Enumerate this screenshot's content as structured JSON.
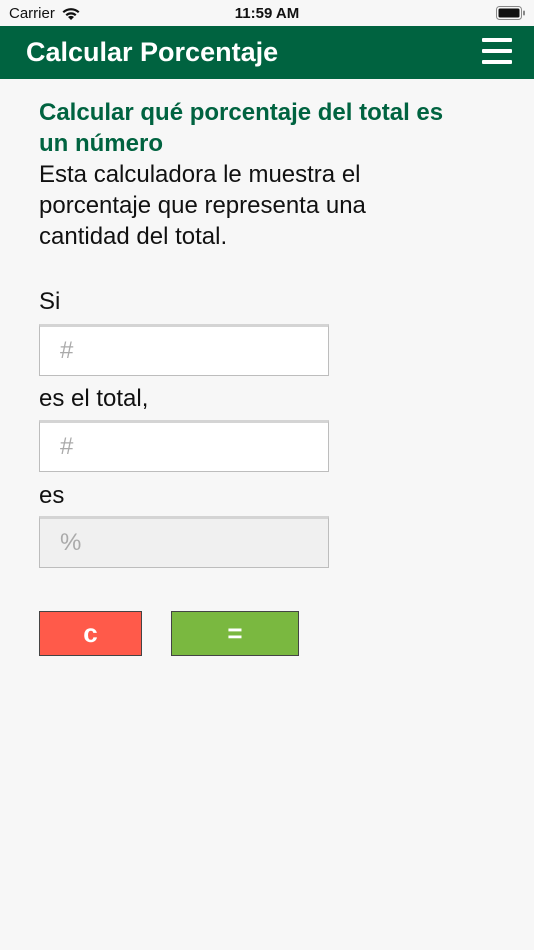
{
  "status_bar": {
    "carrier": "Carrier",
    "time": "11:59 AM"
  },
  "app_bar": {
    "title": "Calcular Porcentaje",
    "background_color": "#006340",
    "menu_icon": "hamburger-menu-icon"
  },
  "intro": {
    "heading": "Calcular qué porcentaje del total es un número",
    "description": "Esta calculadora le muestra el porcentaje que representa una cantidad del total."
  },
  "form": {
    "label_si": "Si",
    "number_placeholder": "#",
    "label_total": "es el total,",
    "total_placeholder": "#",
    "label_es": "es",
    "result_placeholder": "%"
  },
  "buttons": {
    "clear_label": "c",
    "clear_color": "#ff5a4a",
    "equals_label": "=",
    "equals_color": "#7ab840"
  }
}
